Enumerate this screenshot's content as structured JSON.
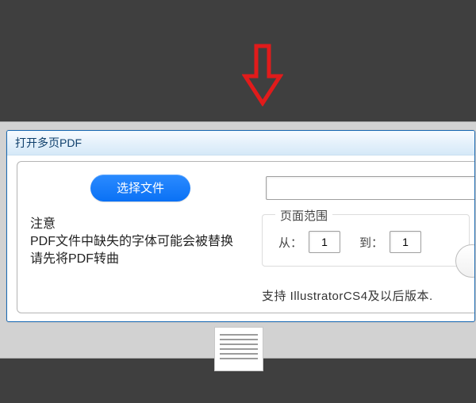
{
  "dialog": {
    "title": "打开多页PDF",
    "choose_file_label": "选择文件",
    "file_path_value": "",
    "notes": {
      "heading": "注意",
      "line1": "PDF文件中缺失的字体可能会被替换",
      "line2": "请先将PDF转曲"
    },
    "page_range": {
      "legend": "页面范围",
      "from_label": "从：",
      "to_label": "到：",
      "from_value": "1",
      "to_value": "1"
    },
    "support_text": "支持 IllustratorCS4及以后版本."
  }
}
